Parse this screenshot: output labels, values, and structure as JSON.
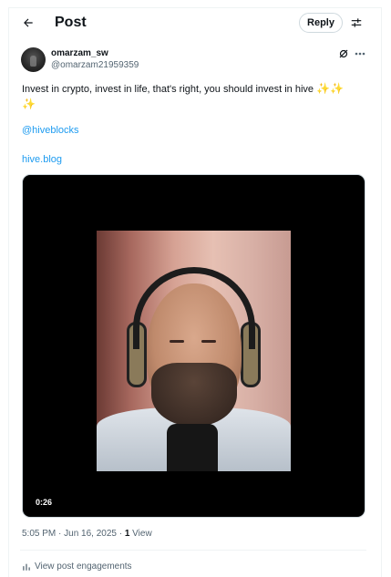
{
  "header": {
    "title": "Post",
    "reply_label": "Reply"
  },
  "post": {
    "display_name": "omarzam_sw",
    "handle": "@omarzam21959359",
    "text": "Invest in crypto, invest in life, that's right, you should invest in hive",
    "sparkles": "✨✨",
    "sparkle_wrap": "✨",
    "mention": "@hiveblocks",
    "link": "hive.blog",
    "video_duration": "0:26",
    "timestamp": "5:05 PM · Jun 16, 2025 · ",
    "view_count": "1",
    "view_label": " View",
    "engagements_label": "View post engagements"
  },
  "icons": {
    "back": "arrow-left-icon",
    "settings": "sliders-icon",
    "grok": "grok-icon",
    "more": "more-horizontal-icon",
    "analytics": "bar-chart-icon"
  },
  "colors": {
    "link": "#1d9bf0",
    "text": "#0f1419",
    "muted": "#536471"
  }
}
